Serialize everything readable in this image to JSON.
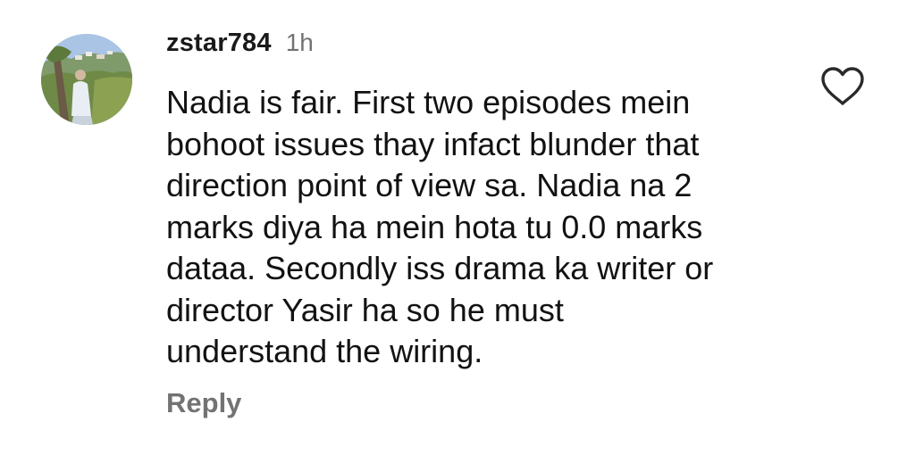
{
  "comment": {
    "username": "zstar784",
    "time": "1h",
    "text": "Nadia is fair. First two episodes mein bohoot issues thay infact blunder that direction point of view sa. Nadia na 2 marks diya ha mein hota tu 0.0 marks dataa. Secondly iss drama ka writer or director Yasir ha so he must understand the wiring.",
    "lines": [
      "Nadia is fair. First two episodes mein",
      "bohoot issues thay infact blunder that",
      "direction point of view sa. Nadia na 2",
      "marks diya ha mein hota tu 0.0 marks",
      "dataa. Secondly iss drama ka writer or",
      "director Yasir ha so he must",
      "understand the wiring."
    ],
    "reply_label": "Reply",
    "like_icon": "heart-outline-icon",
    "avatar_icon": "profile-photo"
  },
  "colors": {
    "username": "#1a1a1a",
    "meta": "#737373",
    "text": "#121212",
    "background": "#ffffff"
  }
}
